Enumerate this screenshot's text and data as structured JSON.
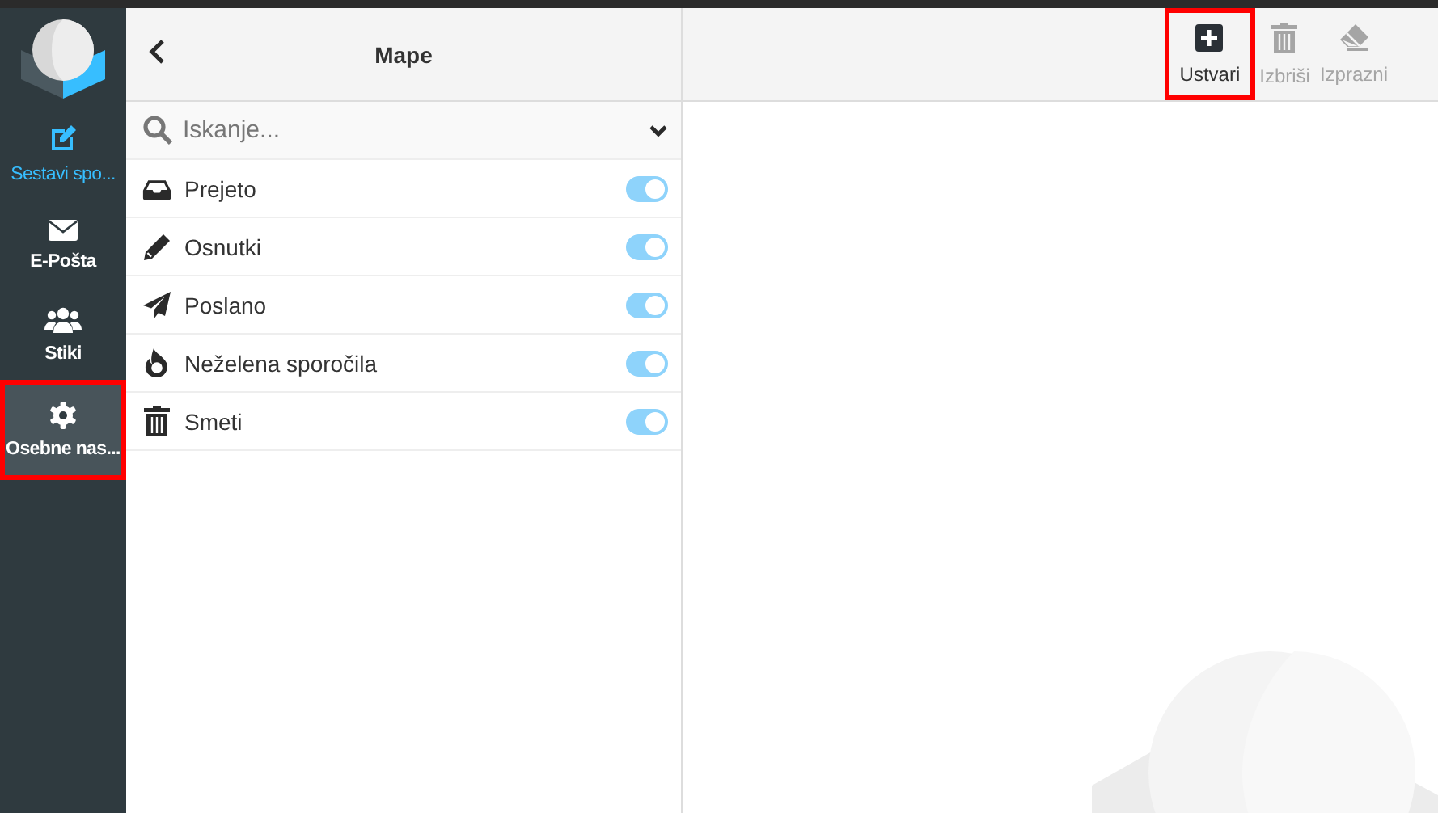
{
  "nav": {
    "items": [
      {
        "label": "Sestavi spo...",
        "kind": "action",
        "selected": false,
        "highlighted": false
      },
      {
        "label": "E-Pošta",
        "kind": "mail",
        "selected": false,
        "highlighted": false
      },
      {
        "label": "Stiki",
        "kind": "contacts",
        "selected": false,
        "highlighted": false
      },
      {
        "label": "Osebne nas...",
        "kind": "settings",
        "selected": true,
        "highlighted": true
      }
    ]
  },
  "folders": {
    "title": "Mape",
    "search": {
      "placeholder": "Iskanje..."
    },
    "items": [
      {
        "name": "Prejeto",
        "kind": "inbox",
        "subscribed": true
      },
      {
        "name": "Osnutki",
        "kind": "drafts",
        "subscribed": true
      },
      {
        "name": "Poslano",
        "kind": "sent",
        "subscribed": true
      },
      {
        "name": "Neželena sporočila",
        "kind": "junk",
        "subscribed": true
      },
      {
        "name": "Smeti",
        "kind": "trash",
        "subscribed": true
      }
    ]
  },
  "toolbar": {
    "buttons": [
      {
        "label": "Ustvari",
        "kind": "create",
        "disabled": false,
        "highlighted": true
      },
      {
        "label": "Izbriši",
        "kind": "delete",
        "disabled": true,
        "highlighted": false
      },
      {
        "label": "Izprazni",
        "kind": "purge",
        "disabled": true,
        "highlighted": false
      }
    ]
  }
}
